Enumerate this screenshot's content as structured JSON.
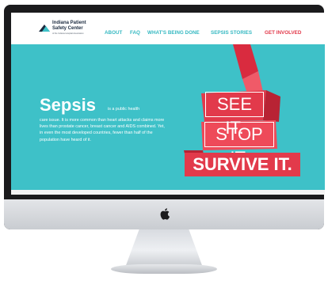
{
  "site": {
    "logo": {
      "title_line1": "Indiana Patient",
      "title_line2": "Safety Center",
      "subtitle": "of the Indiana Hospital Association"
    },
    "nav": {
      "about": "ABOUT",
      "faq": "FAQ",
      "being_done": "WHAT'S BEING DONE",
      "stories": "SEPSIS STORIES",
      "get_involved": "GET INVOLVED"
    },
    "hero": {
      "word": "Sepsis",
      "intro_inline": "is a public health",
      "body": "care issue. It is more common than heart attacks and claims more lives than prostate cancer, breast cancer and AIDS combined. Yet, in even the most developed countries, fewer than half of the population have heard of it.",
      "see": "SEE IT.",
      "stop": "STOP IT.",
      "survive": "SURVIVE IT."
    }
  },
  "colors": {
    "teal": "#3ec1c8",
    "red": "#e23a4b",
    "navy": "#1c2c40",
    "bezel": "#1b1b1d"
  },
  "icons": {
    "apple": "apple-logo-icon",
    "logo_mark": "mountain-logo-icon"
  }
}
